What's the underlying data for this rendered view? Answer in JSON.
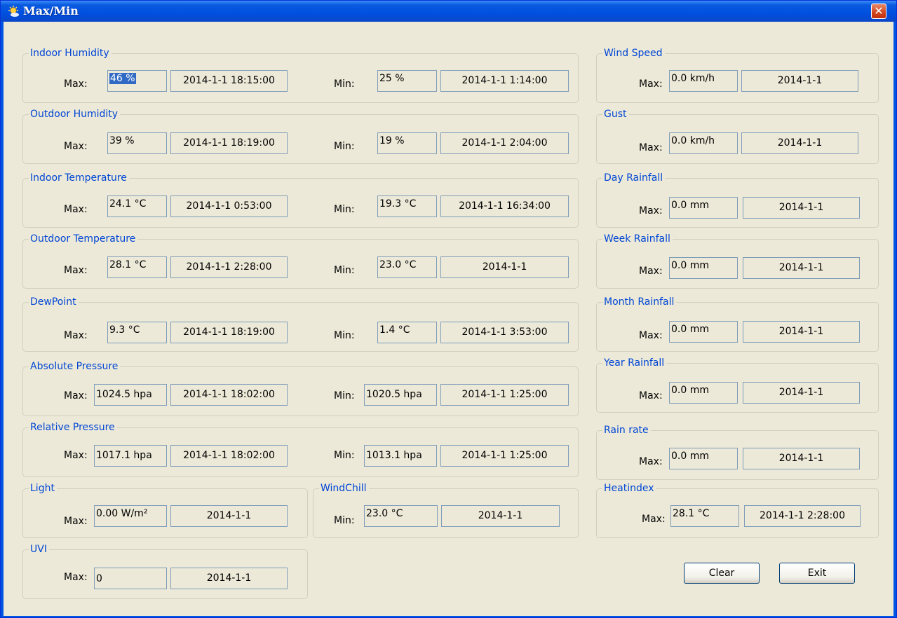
{
  "window": {
    "title": "Max/Min",
    "close_glyph": "✕"
  },
  "groups": {
    "indoor_humidity": {
      "title": "Indoor Humidity",
      "max_label": "Max:",
      "max_value": "46 %",
      "max_time": "2014-1-1 18:15:00",
      "min_label": "Min:",
      "min_value": "25 %",
      "min_time": "2014-1-1 1:14:00"
    },
    "outdoor_humidity": {
      "title": "Outdoor Humidity",
      "max_label": "Max:",
      "max_value": "39 %",
      "max_time": "2014-1-1 18:19:00",
      "min_label": "Min:",
      "min_value": "19 %",
      "min_time": "2014-1-1 2:04:00"
    },
    "indoor_temperature": {
      "title": "Indoor Temperature",
      "max_label": "Max:",
      "max_value": "24.1 °C",
      "max_time": "2014-1-1 0:53:00",
      "min_label": "Min:",
      "min_value": "19.3 °C",
      "min_time": "2014-1-1 16:34:00"
    },
    "outdoor_temperature": {
      "title": "Outdoor Temperature",
      "max_label": "Max:",
      "max_value": "28.1 °C",
      "max_time": "2014-1-1 2:28:00",
      "min_label": "Min:",
      "min_value": "23.0 °C",
      "min_time": "2014-1-1"
    },
    "dewpoint": {
      "title": "DewPoint",
      "max_label": "Max:",
      "max_value": "9.3 °C",
      "max_time": "2014-1-1 18:19:00",
      "min_label": "Min:",
      "min_value": "1.4 °C",
      "min_time": "2014-1-1 3:53:00"
    },
    "absolute_pressure": {
      "title": "Absolute Pressure",
      "max_label": "Max:",
      "max_value": "1024.5 hpa",
      "max_time": "2014-1-1 18:02:00",
      "min_label": "Min:",
      "min_value": "1020.5 hpa",
      "min_time": "2014-1-1 1:25:00"
    },
    "relative_pressure": {
      "title": "Relative Pressure",
      "max_label": "Max:",
      "max_value": "1017.1 hpa",
      "max_time": "2014-1-1 18:02:00",
      "min_label": "Min:",
      "min_value": "1013.1 hpa",
      "min_time": "2014-1-1 1:25:00"
    },
    "light": {
      "title": "Light",
      "max_label": "Max:",
      "max_value": "0.00 W/m²",
      "max_time": "2014-1-1"
    },
    "windchill": {
      "title": "WindChill",
      "min_label": "Min:",
      "min_value": "23.0 °C",
      "min_time": "2014-1-1"
    },
    "uvi": {
      "title": "UVI",
      "max_label": "Max:",
      "max_value": "0",
      "max_time": "2014-1-1"
    },
    "wind_speed": {
      "title": "Wind Speed",
      "max_label": "Max:",
      "max_value": "0.0 km/h",
      "max_time": "2014-1-1"
    },
    "gust": {
      "title": "Gust",
      "max_label": "Max:",
      "max_value": "0.0 km/h",
      "max_time": "2014-1-1"
    },
    "day_rainfall": {
      "title": "Day Rainfall",
      "max_label": "Max:",
      "max_value": "0.0 mm",
      "max_time": "2014-1-1"
    },
    "week_rainfall": {
      "title": "Week Rainfall",
      "max_label": "Max:",
      "max_value": "0.0 mm",
      "max_time": "2014-1-1"
    },
    "month_rainfall": {
      "title": "Month Rainfall",
      "max_label": "Max:",
      "max_value": "0.0 mm",
      "max_time": "2014-1-1"
    },
    "year_rainfall": {
      "title": "Year Rainfall",
      "max_label": "Max:",
      "max_value": "0.0 mm",
      "max_time": "2014-1-1"
    },
    "rain_rate": {
      "title": "Rain rate",
      "max_label": "Max:",
      "max_value": "0.0 mm",
      "max_time": "2014-1-1"
    },
    "heatindex": {
      "title": "Heatindex",
      "max_label": "Max:",
      "max_value": "28.1 °C",
      "max_time": "2014-1-1 2:28:00"
    }
  },
  "buttons": {
    "clear": "Clear",
    "exit": "Exit"
  },
  "icons": {
    "app": "weather-sun-icon",
    "close": "close-icon"
  },
  "colors": {
    "titlebar": "#0054e3",
    "client": "#ece9d8",
    "legend_text": "#0046d5",
    "field_border": "#7f9db9",
    "close_button": "#d2441c",
    "selection": "#316ac5"
  }
}
